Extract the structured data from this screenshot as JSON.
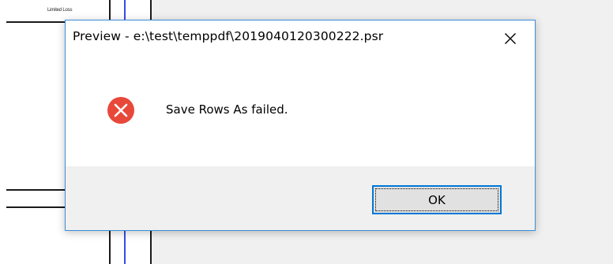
{
  "background": {
    "report_heading": "Limited Loss"
  },
  "dialog": {
    "title": "Preview - e:\\test\\temppdf\\2019040120300222.psr",
    "close_icon": "close-icon",
    "message_icon": "error-icon",
    "message": "Save Rows As failed.",
    "ok_label": "OK"
  },
  "colors": {
    "error_red": "#e8483a",
    "accent_blue": "#0078d7",
    "dialog_border": "#3b8ed9",
    "button_bar": "#f0f0f0",
    "button_face": "#e1e1e1"
  }
}
